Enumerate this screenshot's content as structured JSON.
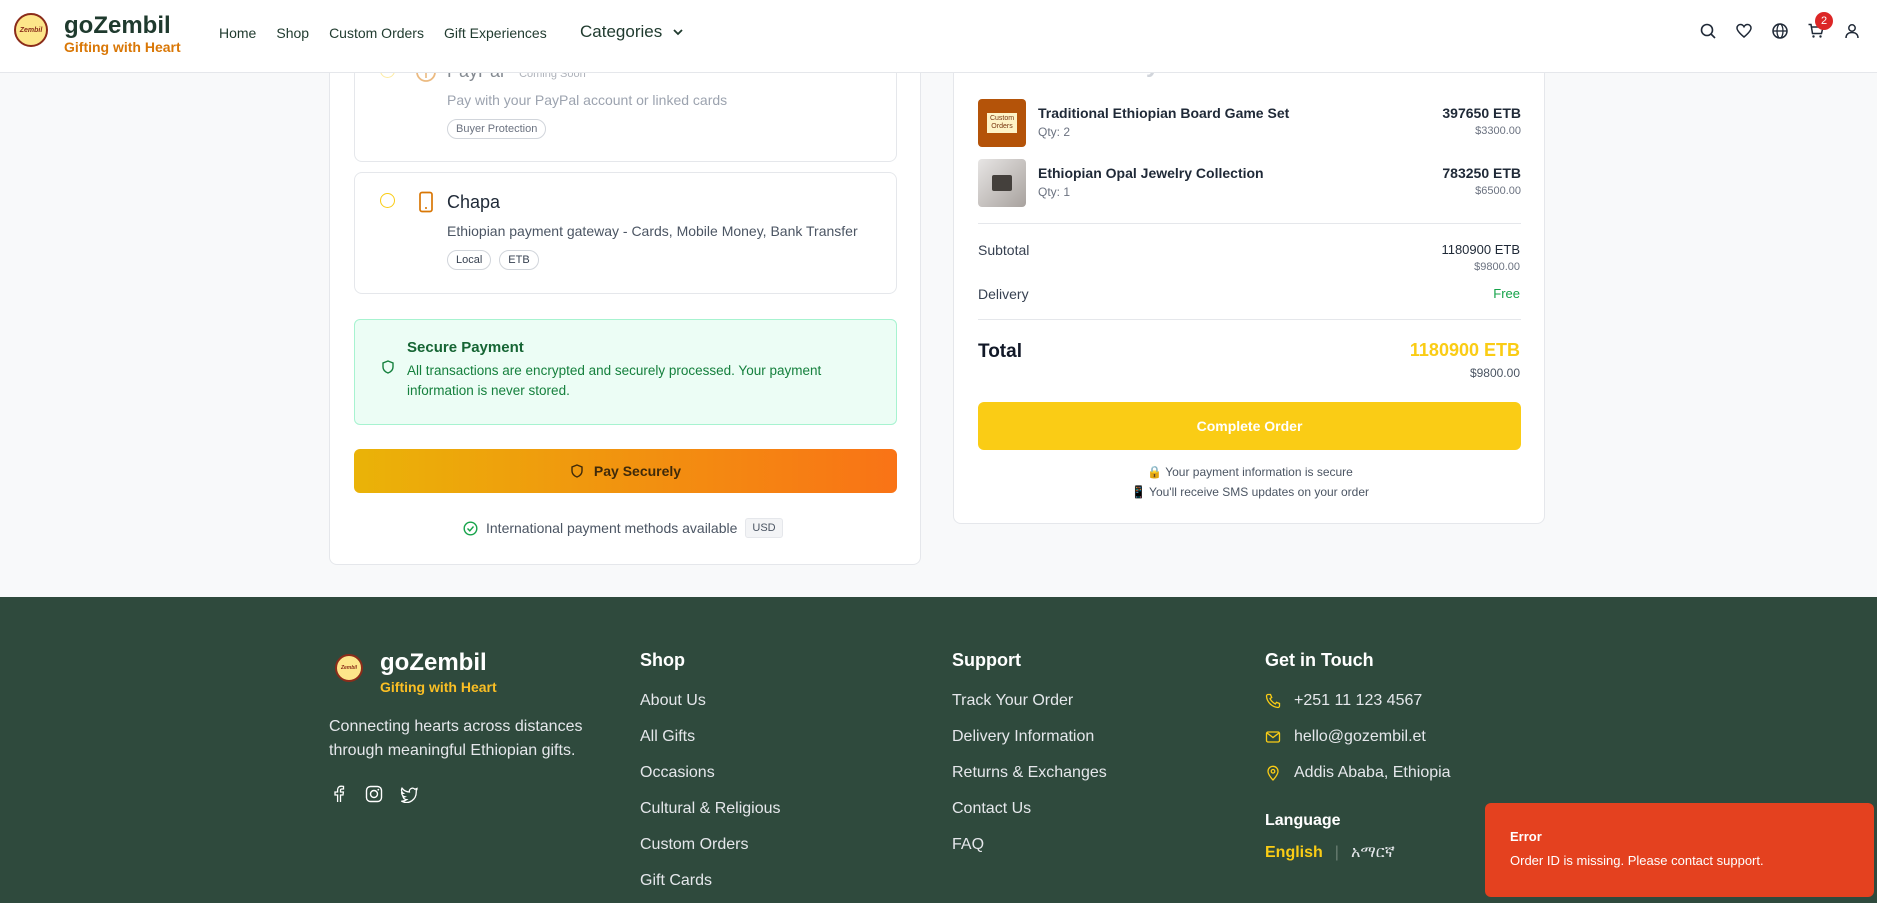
{
  "header": {
    "brand_name": "goZembil",
    "brand_tagline": "Gifting with Heart",
    "logo_text": "Zembil",
    "nav": [
      "Home",
      "Shop",
      "Custom Orders",
      "Gift Experiences"
    ],
    "categories_label": "Categories",
    "cart_count": "2"
  },
  "payment": {
    "paypal": {
      "title": "PayPal",
      "badge": "Coming Soon",
      "subtitle": "Pay with your PayPal account or linked cards",
      "tags": [
        "Buyer Protection"
      ]
    },
    "chapa": {
      "title": "Chapa",
      "subtitle": "Ethiopian payment gateway - Cards, Mobile Money, Bank Transfer",
      "tags": [
        "Local",
        "ETB"
      ]
    },
    "secure": {
      "title": "Secure Payment",
      "text": "All transactions are encrypted and securely processed. Your payment information is never stored."
    },
    "pay_button": "Pay Securely",
    "intl_text": "International payment methods available",
    "intl_badge": "USD"
  },
  "summary": {
    "title": "Order Summary",
    "items": [
      {
        "name": "Traditional Ethiopian Board Game Set",
        "qty": "Qty: 2",
        "etb": "397650 ETB",
        "usd": "$3300.00",
        "thumb_text": "Custom Orders"
      },
      {
        "name": "Ethiopian Opal Jewelry Collection",
        "qty": "Qty: 1",
        "etb": "783250 ETB",
        "usd": "$6500.00",
        "thumb_text": ""
      }
    ],
    "subtotal_label": "Subtotal",
    "subtotal_etb": "1180900 ETB",
    "subtotal_usd": "$9800.00",
    "delivery_label": "Delivery",
    "delivery_value": "Free",
    "total_label": "Total",
    "total_etb": "1180900 ETB",
    "total_usd": "$9800.00",
    "complete_button": "Complete Order",
    "note_secure": "🔒 Your payment information is secure",
    "note_sms": "📱 You'll receive SMS updates on your order"
  },
  "footer": {
    "brand_name": "goZembil",
    "brand_tagline": "Gifting with Heart",
    "logo_text": "Zembil",
    "description": "Connecting hearts across distances through meaningful Ethiopian gifts.",
    "shop_title": "Shop",
    "shop_links": [
      "About Us",
      "All Gifts",
      "Occasions",
      "Cultural & Religious",
      "Custom Orders",
      "Gift Cards"
    ],
    "support_title": "Support",
    "support_links": [
      "Track Your Order",
      "Delivery Information",
      "Returns & Exchanges",
      "Contact Us",
      "FAQ"
    ],
    "contact_title": "Get in Touch",
    "phone": "+251 11 123 4567",
    "email": "hello@gozembil.et",
    "address": "Addis Ababa, Ethiopia",
    "language_title": "Language",
    "lang_english": "English",
    "lang_separator": "|",
    "lang_amharic": "አማርኛ"
  },
  "toast": {
    "title": "Error",
    "message": "Order ID is missing. Please contact support."
  },
  "colors": {
    "accent": "#facc15",
    "brand_dark": "#2f4a3d",
    "orange": "#f97316",
    "error": "#e4411f",
    "success": "#16a34a"
  }
}
